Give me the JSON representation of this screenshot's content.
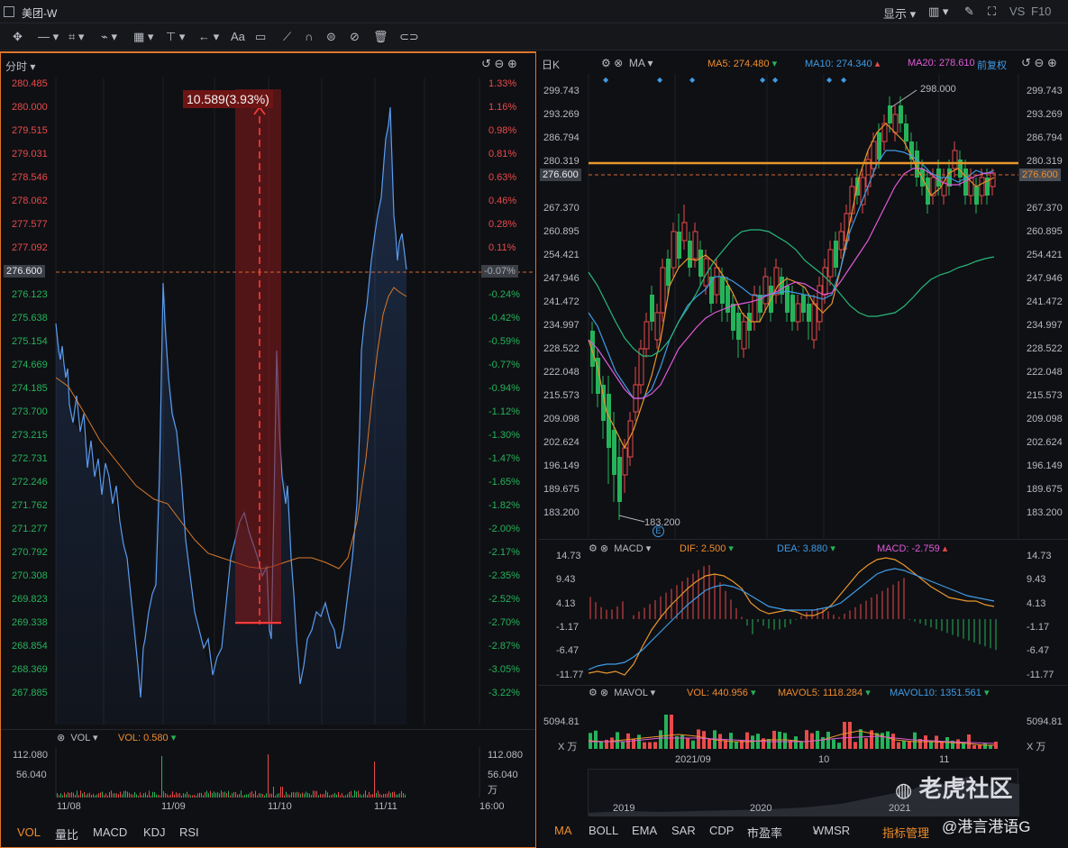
{
  "window": {
    "title": "美团-W",
    "display_label": "显示",
    "vs_label": "VS",
    "f10_label": "F10"
  },
  "left": {
    "period": "分时",
    "annotation": "10.589(3.93%)",
    "last_price": "276.600",
    "price_ticks": [
      "280.485",
      "280.000",
      "279.515",
      "279.031",
      "278.546",
      "278.062",
      "277.577",
      "277.092",
      "276.600",
      "276.123",
      "275.638",
      "275.154",
      "274.669",
      "274.185",
      "273.700",
      "273.215",
      "272.731",
      "272.246",
      "271.762",
      "271.277",
      "270.792",
      "270.308",
      "269.823",
      "269.338",
      "268.854",
      "268.369",
      "267.885"
    ],
    "pct_ticks": [
      "1.33%",
      "1.16%",
      "0.98%",
      "0.81%",
      "0.63%",
      "0.46%",
      "0.28%",
      "0.11%",
      "-0.07%",
      "-0.24%",
      "-0.42%",
      "-0.59%",
      "-0.77%",
      "-0.94%",
      "-1.12%",
      "-1.30%",
      "-1.47%",
      "-1.65%",
      "-1.82%",
      "-2.00%",
      "-2.17%",
      "-2.35%",
      "-2.52%",
      "-2.70%",
      "-2.87%",
      "-3.05%",
      "-3.22%"
    ],
    "vol_label": "VOL",
    "vol_value": "VOL: 0.580",
    "vol_ticks": [
      "112.080",
      "56.040"
    ],
    "vol_unit": "万",
    "x_ticks": [
      "11/08",
      "11/09",
      "11/10",
      "11/11",
      "16:00"
    ],
    "bottom_tabs": [
      "VOL",
      "量比",
      "MACD",
      "KDJ",
      "RSI"
    ]
  },
  "right": {
    "period": "日K",
    "ma_label": "MA",
    "ma5": "MA5: 274.480",
    "ma10": "MA10: 274.340",
    "ma20": "MA20: 278.610",
    "adjust": "前复权",
    "price_ticks": [
      "299.743",
      "293.269",
      "286.794",
      "280.319",
      "273.845",
      "267.370",
      "260.895",
      "254.421",
      "247.946",
      "241.472",
      "234.997",
      "228.522",
      "222.048",
      "215.573",
      "209.098",
      "202.624",
      "196.149",
      "189.675",
      "183.200"
    ],
    "last_price": "276.600",
    "high_label": "298.000",
    "low_label": "183.200",
    "event_label": "E",
    "macd_label": "MACD",
    "dif": "DIF: 2.500",
    "dea": "DEA: 3.880",
    "macd": "MACD: -2.759",
    "macd_ticks": [
      "14.73",
      "9.43",
      "4.13",
      "-1.17",
      "-6.47",
      "-11.77"
    ],
    "mavol_label": "MAVOL",
    "vol": "VOL: 440.956",
    "mavol5": "MAVOL5: 1118.284",
    "mavol10": "MAVOL10: 1351.561",
    "vol_ticks": [
      "5094.81",
      "X 万"
    ],
    "x_ticks": [
      "2021/09",
      "10",
      "11"
    ],
    "year_ticks": [
      "2019",
      "2020",
      "2021"
    ],
    "bottom_tabs": [
      "MA",
      "BOLL",
      "EMA",
      "SAR",
      "CDP",
      "市盈率",
      "WMSR",
      "指标管理"
    ],
    "watermark": "老虎社区",
    "watermark2": "@港言港语G"
  },
  "chart_data": [
    {
      "type": "line",
      "title": "",
      "x": [
        "11/08",
        "11/09",
        "11/10",
        "11/11"
      ],
      "series": [
        {
          "values": [
            273.9,
            266.9,
            276.4,
            271.6,
            270.9,
            279.5,
            276.6
          ]
        },
        {
          "values": [
            273.0,
            271.2,
            271.0,
            270.8,
            270.3,
            277.2,
            277.1
          ]
        }
      ],
      "ylim": [
        267.885,
        280.485
      ]
    },
    {
      "type": "line",
      "title": "",
      "x": [
        "2021/09",
        "10",
        "11"
      ],
      "series": [
        {
          "name": "MA5",
          "values": [
            228,
            205,
            245,
            250,
            232,
            243,
            275,
            282,
            272,
            274.48
          ]
        },
        {
          "name": "MA10",
          "values": [
            235,
            212,
            230,
            248,
            240,
            242,
            260,
            282,
            270,
            274.34
          ]
        },
        {
          "name": "MA20",
          "values": [
            248,
            230,
            225,
            245,
            240,
            238,
            252,
            270,
            277,
            278.61
          ]
        }
      ],
      "ylim": [
        183.2,
        299.743
      ]
    }
  ]
}
